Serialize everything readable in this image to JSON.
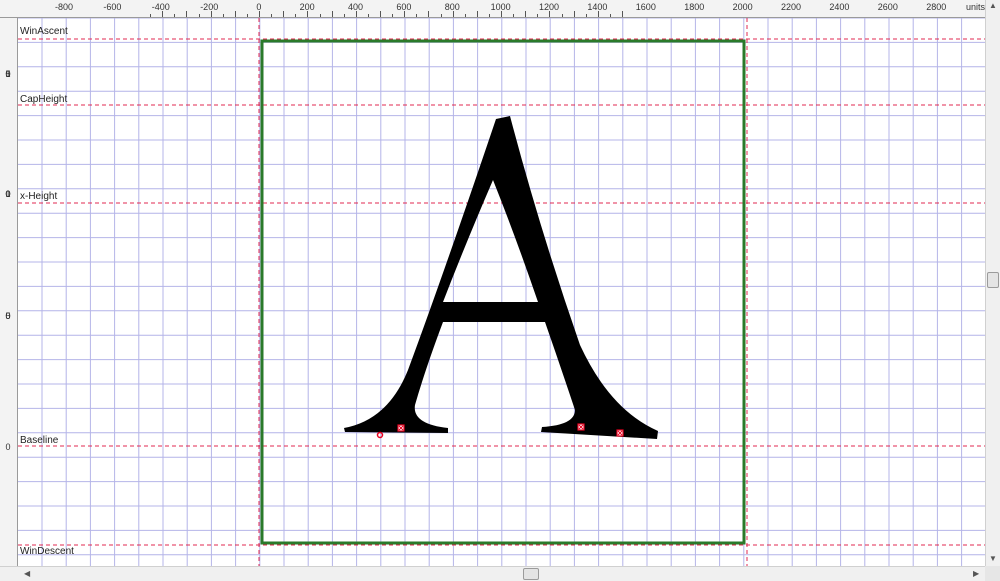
{
  "ruler": {
    "unit_label": "units",
    "h_ticks": [
      "-800",
      "-600",
      "-400",
      "-200",
      "0",
      "200",
      "400",
      "600",
      "800",
      "1000",
      "1200",
      "1400",
      "1600",
      "1800",
      "2000",
      "2200",
      "2400",
      "2600",
      "2800"
    ],
    "v_ticks": [
      {
        "digits": [
          "1",
          "5",
          "0",
          "0"
        ]
      },
      {
        "digits": [
          "1",
          "0",
          "0",
          "0"
        ]
      },
      {
        "digits": [
          "5",
          "0",
          "0"
        ]
      },
      {
        "digits": [
          "0"
        ]
      }
    ]
  },
  "metrics": {
    "win_ascent": "WinAscent",
    "cap_height": "CapHeight",
    "x_height": "x-Height",
    "baseline": "Baseline",
    "win_descent": "WinDescent"
  },
  "glyph": {
    "character": "A",
    "fill": "#000000"
  },
  "colors": {
    "grid": "#b4b4e8",
    "metric_line": "#e02850",
    "advance_box": "#2a7a2a",
    "point_marker": "#e8001e"
  }
}
